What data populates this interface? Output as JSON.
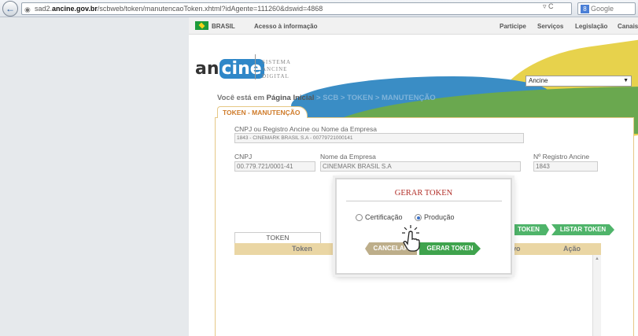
{
  "browser": {
    "back_icon": "←",
    "url_prefix": "sad2.",
    "url_domain": "ancine.gov.br",
    "url_path": "/scbweb/token/manutencaoToken.xhtml?idAgente=111260&dswid=4868",
    "url_actions": "▿ C",
    "search_engine": "8",
    "search_placeholder": "Google"
  },
  "gov_bar": {
    "country": "BRASIL",
    "info_link": "Acesso à informação",
    "links": [
      "Participe",
      "Serviços",
      "Legislação",
      "Canais"
    ]
  },
  "header": {
    "logo_an": "an",
    "logo_cine": "cine",
    "logo_sub": [
      "SISTEMA",
      "ANCINE",
      "DIGITAL"
    ],
    "select_value": "Ancine"
  },
  "breadcrumb": {
    "prefix": "Você está em ",
    "home": "Página Inicial",
    "trail": " > SCB > TOKEN > MANUTENÇÃO"
  },
  "panel": {
    "tab_label": "TOKEN - MANUTENÇÃO",
    "search_label": "CNPJ ou Registro Ancine ou Nome da Empresa",
    "search_value": "1843 - CINEMARK BRASIL S.A - 00779721000141",
    "cnpj_label": "CNPJ",
    "cnpj_value": "00.779.721/0001-41",
    "company_label": "Nome da Empresa",
    "company_value": "CINEMARK BRASIL S.A",
    "registro_label": "Nº Registro Ancine",
    "registro_value": "1843",
    "btn_token": "TOKEN",
    "btn_listar": "LISTAR TOKEN"
  },
  "grid": {
    "tab_label": "TOKEN",
    "columns": [
      "Token",
      "vo",
      "Ação"
    ]
  },
  "modal": {
    "title": "GERAR TOKEN",
    "options": [
      "Certificação",
      "Produção"
    ],
    "selected": "Produção",
    "cancel_label": "CANCELAR",
    "confirm_label": "GERAR TOKEN"
  },
  "colors": {
    "accent_green": "#3fa34d",
    "title_red": "#b2302a",
    "panel_border": "#e6c886",
    "tab_orange": "#cf7b2a"
  },
  "icons": [
    "back-arrow-icon",
    "globe-icon",
    "brazil-flag-icon",
    "hand-cursor-icon"
  ]
}
